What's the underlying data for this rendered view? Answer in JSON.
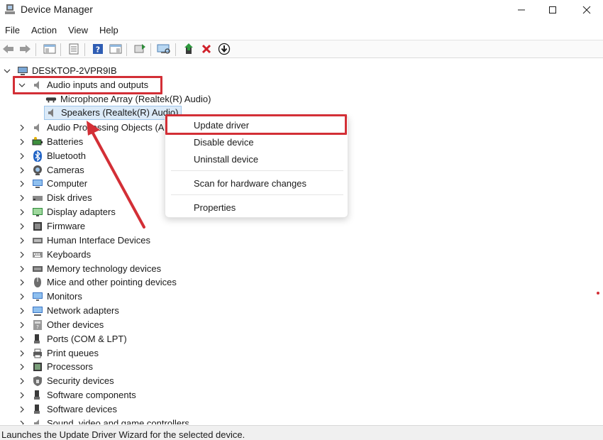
{
  "window": {
    "title": "Device Manager"
  },
  "menu": [
    "File",
    "Action",
    "View",
    "Help"
  ],
  "toolbar_icons": [
    "back-icon",
    "forward-icon",
    "show-hide-console-tree-icon",
    "properties-icon",
    "help-icon",
    "action-pane-icon",
    "refresh-icon",
    "scan-hardware-icon",
    "update-driver-icon",
    "uninstall-icon",
    "disable-icon"
  ],
  "tree": {
    "root": "DESKTOP-2VPR9IB",
    "audio_category": "Audio inputs and outputs",
    "audio_children": [
      "Microphone Array (Realtek(R) Audio)",
      "Speakers (Realtek(R) Audio)"
    ],
    "categories": [
      "Audio Processing Objects (APOs)",
      "Batteries",
      "Bluetooth",
      "Cameras",
      "Computer",
      "Disk drives",
      "Display adapters",
      "Firmware",
      "Human Interface Devices",
      "Keyboards",
      "Memory technology devices",
      "Mice and other pointing devices",
      "Monitors",
      "Network adapters",
      "Other devices",
      "Ports (COM & LPT)",
      "Print queues",
      "Processors",
      "Security devices",
      "Software components",
      "Software devices",
      "Sound, video and game controllers"
    ]
  },
  "context_menu": {
    "update_driver": "Update driver",
    "disable_device": "Disable device",
    "uninstall_device": "Uninstall device",
    "scan_hardware": "Scan for hardware changes",
    "properties": "Properties"
  },
  "status": "Launches the Update Driver Wizard for the selected device.",
  "colors": {
    "annotation": "#d32f36",
    "selection": "#dbeaf8"
  }
}
